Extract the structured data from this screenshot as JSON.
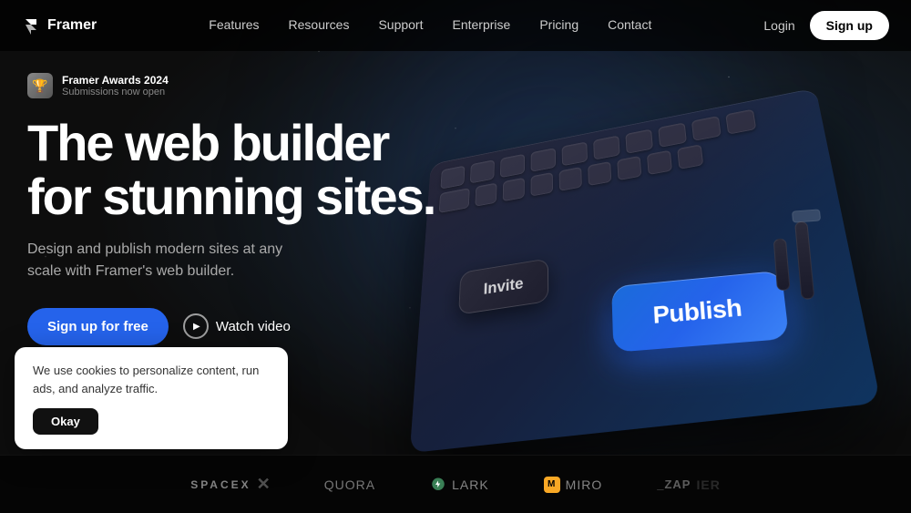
{
  "nav": {
    "logo_label": "Framer",
    "links": [
      {
        "label": "Features",
        "href": "#"
      },
      {
        "label": "Resources",
        "href": "#"
      },
      {
        "label": "Support",
        "href": "#"
      },
      {
        "label": "Enterprise",
        "href": "#"
      },
      {
        "label": "Pricing",
        "href": "#"
      },
      {
        "label": "Contact",
        "href": "#"
      }
    ],
    "login_label": "Login",
    "signup_label": "Sign up"
  },
  "award": {
    "title": "Framer Awards 2024",
    "subtitle": "Submissions now open"
  },
  "hero": {
    "heading_line1": "The web builder",
    "heading_line2": "for stunning sites.",
    "subtext": "Design and publish modern sites at any scale with Framer's web builder.",
    "cta_primary": "Sign up for free",
    "cta_secondary": "Watch video"
  },
  "keyboard": {
    "invite_label": "Invite",
    "publish_label": "Publish"
  },
  "logos": [
    {
      "id": "spacex",
      "label": "SPACEX"
    },
    {
      "id": "quora",
      "label": "Quora"
    },
    {
      "id": "lark",
      "label": "Lark"
    },
    {
      "id": "miro",
      "label": "miro"
    },
    {
      "id": "zapier",
      "label": "_zap"
    }
  ],
  "cookie": {
    "text": "We use cookies to personalize content, run ads, and analyze traffic.",
    "button_label": "Okay"
  }
}
